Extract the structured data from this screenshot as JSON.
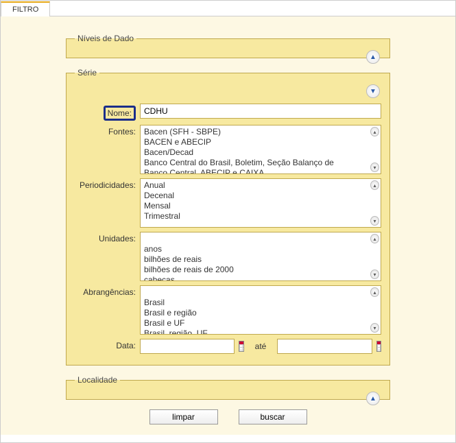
{
  "tab": {
    "filtro": "FILTRO"
  },
  "niveis": {
    "legend": "Níveis de Dado",
    "toggle": "▲"
  },
  "serie": {
    "legend": "Série",
    "toggle": "▼",
    "nome_label": "Nome:",
    "nome_value": "CDHU",
    "fontes_label": "Fontes:",
    "fontes": [
      "Bacen (SFH - SBPE)",
      "BACEN e ABECIP",
      "Bacen/Decad",
      "Banco Central do Brasil, Boletim, Seção Balanço de",
      "Banco Central, ABECIP e CAIXA"
    ],
    "period_label": "Periodicidades:",
    "period": [
      "Anual",
      "Decenal",
      "Mensal",
      "Trimestral"
    ],
    "unidades_label": "Unidades:",
    "unidades": [
      "",
      "anos",
      "bilhões de reais",
      "bilhões de reais de 2000",
      "cabeças"
    ],
    "abrang_label": "Abrangências:",
    "abrang": [
      "",
      "Brasil",
      "Brasil e região",
      "Brasil e UF",
      "Brasil, região, UF"
    ],
    "data_label": "Data:",
    "ate": "até"
  },
  "localidade": {
    "legend": "Localidade",
    "toggle": "▲"
  },
  "buttons": {
    "limpar": "limpar",
    "buscar": "buscar"
  }
}
